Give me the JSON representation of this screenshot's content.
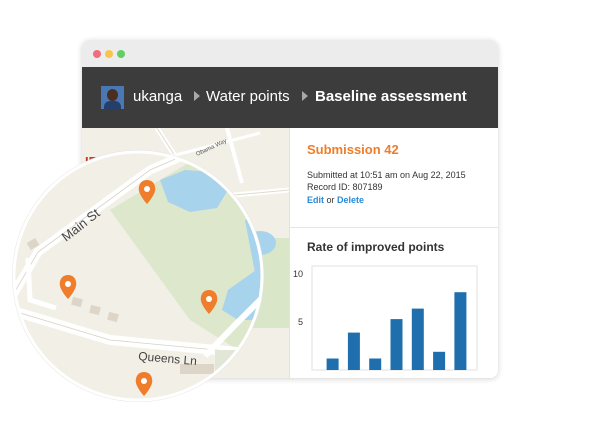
{
  "breadcrumb": {
    "user": "ukanga",
    "section": "Water points",
    "page": "Baseline assessment"
  },
  "submission": {
    "title": "Submission 42",
    "submitted_at": "Submitted at 10:51 am on Aug 22, 2015",
    "record_id": "Record ID: 807189",
    "edit_label": "Edit",
    "or_label": "or",
    "delete_label": "Delete"
  },
  "map": {
    "labels": {
      "main_st": "Main St",
      "queens_ln": "Queens Ln",
      "obama_way": "Obama Way",
      "district": "IRU"
    }
  },
  "colors": {
    "accent_orange": "#ef7d2b",
    "link_blue": "#2a8ad9",
    "bar_blue": "#1f6fae",
    "header_bg": "#3c3c3c",
    "water": "#a8d3ec",
    "park": "#d9e6c8"
  },
  "chart_data": {
    "type": "bar",
    "title": "Rate of improved points",
    "y_ticks": [
      "10",
      "5"
    ],
    "ylim": [
      0,
      10
    ],
    "grid": false,
    "values": [
      1.2,
      3.9,
      1.2,
      5.3,
      6.4,
      1.9,
      8.1
    ],
    "color": "#1f6fae"
  }
}
